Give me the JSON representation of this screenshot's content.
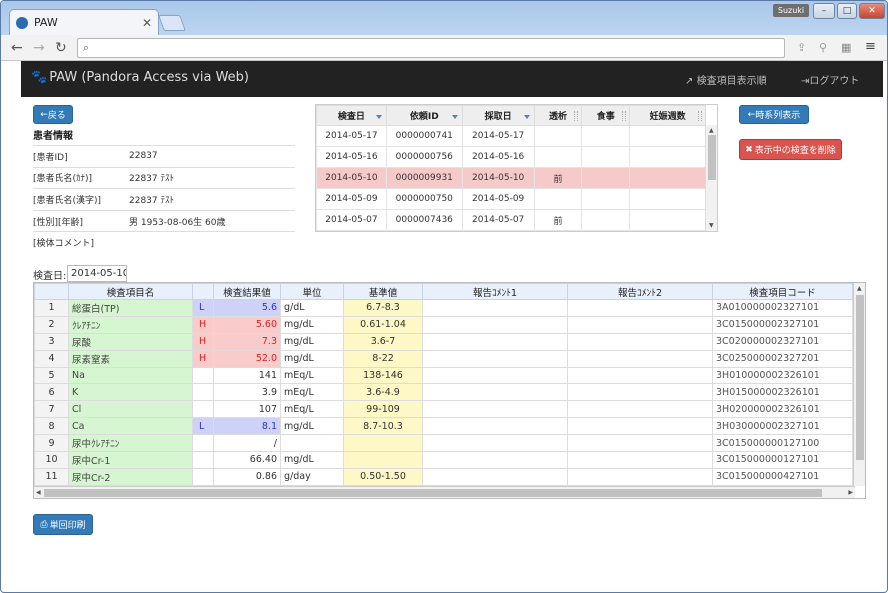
{
  "browser": {
    "tab_title": "PAW",
    "user_badge": "Suzuki",
    "url": ""
  },
  "app": {
    "brand": "PAW (Pandora Access via Web)",
    "nav_order": "検査項目表示順",
    "nav_logout": "ログアウト"
  },
  "buttons": {
    "back": "戻る",
    "timeseries": "時系列表示",
    "delete": "表示中の検査を削除",
    "print": "単回印刷"
  },
  "patient": {
    "heading": "患者情報",
    "rows": [
      {
        "label": "[患者ID]",
        "value": "22837"
      },
      {
        "label": "[患者氏名(ｶﾅ)]",
        "value": "22837 ﾃｽﾄ"
      },
      {
        "label": "[患者氏名(漢字)]",
        "value": "22837 ﾃｽﾄ"
      },
      {
        "label": "[性別][年齢]",
        "value": "男 1953-08-06生 60歳"
      },
      {
        "label": "[検体コメント]",
        "value": ""
      }
    ]
  },
  "orders": {
    "headers": [
      "検査日",
      "依頼ID",
      "採取日",
      "透析",
      "食事",
      "妊娠週数"
    ],
    "rows": [
      [
        "2014-05-17",
        "0000000741",
        "2014-05-17",
        "",
        "",
        ""
      ],
      [
        "2014-05-16",
        "0000000756",
        "2014-05-16",
        "",
        "",
        ""
      ],
      [
        "2014-05-10",
        "0000009931",
        "2014-05-10",
        "前",
        "",
        ""
      ],
      [
        "2014-05-09",
        "0000000750",
        "2014-05-09",
        "",
        "",
        ""
      ],
      [
        "2014-05-07",
        "0000007436",
        "2014-05-07",
        "前",
        "",
        ""
      ]
    ],
    "selected_index": 2
  },
  "exam_date": {
    "label": "検査日:",
    "value": "2014-05-10"
  },
  "results": {
    "headers": [
      "",
      "検査項目名",
      "",
      "検査結果値",
      "単位",
      "基準値",
      "報告ｺﾒﾝﾄ1",
      "報告ｺﾒﾝﾄ2",
      "検査項目コード"
    ],
    "rows": [
      {
        "no": "1",
        "name": "総蛋白(TP)",
        "flag": "L",
        "value": "5.6",
        "unit": "g/dL",
        "ref": "6.7-8.3",
        "c1": "",
        "c2": "",
        "code": "3A010000002327101"
      },
      {
        "no": "2",
        "name": "ｸﾚｱﾁﾆﾝ",
        "flag": "H",
        "value": "5.60",
        "unit": "mg/dL",
        "ref": "0.61-1.04",
        "c1": "",
        "c2": "",
        "code": "3C015000002327101"
      },
      {
        "no": "3",
        "name": "尿酸",
        "flag": "H",
        "value": "7.3",
        "unit": "mg/dL",
        "ref": "3.6-7",
        "c1": "",
        "c2": "",
        "code": "3C020000002327101"
      },
      {
        "no": "4",
        "name": "尿素窒素",
        "flag": "H",
        "value": "52.0",
        "unit": "mg/dL",
        "ref": "8-22",
        "c1": "",
        "c2": "",
        "code": "3C025000002327201"
      },
      {
        "no": "5",
        "name": "Na",
        "flag": "",
        "value": "141",
        "unit": "mEq/L",
        "ref": "138-146",
        "c1": "",
        "c2": "",
        "code": "3H010000002326101"
      },
      {
        "no": "6",
        "name": "K",
        "flag": "",
        "value": "3.9",
        "unit": "mEq/L",
        "ref": "3.6-4.9",
        "c1": "",
        "c2": "",
        "code": "3H015000002326101"
      },
      {
        "no": "7",
        "name": "Cl",
        "flag": "",
        "value": "107",
        "unit": "mEq/L",
        "ref": "99-109",
        "c1": "",
        "c2": "",
        "code": "3H020000002326101"
      },
      {
        "no": "8",
        "name": "Ca",
        "flag": "L",
        "value": "8.1",
        "unit": "mg/dL",
        "ref": "8.7-10.3",
        "c1": "",
        "c2": "",
        "code": "3H030000002327101"
      },
      {
        "no": "9",
        "name": "尿中ｸﾚｱﾁﾆﾝ",
        "flag": "",
        "value": "/",
        "unit": "",
        "ref": "",
        "c1": "",
        "c2": "",
        "code": "3C015000000127100"
      },
      {
        "no": "10",
        "name": "尿中Cr-1",
        "flag": "",
        "value": "66.40",
        "unit": "mg/dL",
        "ref": "",
        "c1": "",
        "c2": "",
        "code": "3C015000000127101"
      },
      {
        "no": "11",
        "name": "尿中Cr-2",
        "flag": "",
        "value": "0.86",
        "unit": "g/day",
        "ref": "0.50-1.50",
        "c1": "",
        "c2": "",
        "code": "3C015000000427101"
      }
    ]
  },
  "colors": {
    "navbar": "#222222",
    "primary": "#337ab7",
    "danger": "#d9534f",
    "high": "#e02020",
    "low": "#2a36c8",
    "name_cell": "#d6f5d1",
    "ref_cell": "#fdf8c5",
    "selected_row": "#f7caca"
  }
}
